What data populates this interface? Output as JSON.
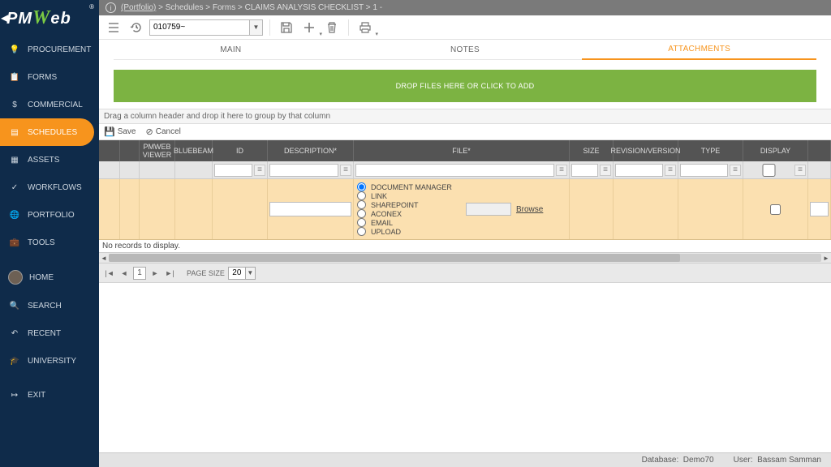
{
  "breadcrumb": {
    "portfolio": "(Portfolio)",
    "sep": ">",
    "p1": "Schedules",
    "p2": "Forms",
    "p3": "CLAIMS ANALYSIS CHECKLIST",
    "p4": "1 -"
  },
  "toolbar": {
    "record_id": "010759~"
  },
  "sidebar": {
    "items": [
      "PROCUREMENT",
      "FORMS",
      "COMMERCIAL",
      "SCHEDULES",
      "ASSETS",
      "WORKFLOWS",
      "PORTFOLIO",
      "TOOLS",
      "HOME",
      "SEARCH",
      "RECENT",
      "UNIVERSITY",
      "EXIT"
    ]
  },
  "tabs": {
    "main": "MAIN",
    "notes": "NOTES",
    "attachments": "ATTACHMENTS"
  },
  "dropzone": "DROP FILES HERE OR CLICK TO ADD",
  "group_bar": "Drag a column header and drop it here to group by that column",
  "actions": {
    "save": "Save",
    "cancel": "Cancel"
  },
  "cols": {
    "pmweb": "PMWEB VIEWER",
    "bluebeam": "BLUEBEAM",
    "id": "ID",
    "description": "DESCRIPTION*",
    "file": "FILE*",
    "size": "SIZE",
    "revision": "REVISION/VERSION",
    "type": "TYPE",
    "display": "DISPLAY"
  },
  "radio": {
    "docmgr": "DOCUMENT MANAGER",
    "link": "LINK",
    "sharepoint": "SHAREPOINT",
    "aconex": "ACONEX",
    "email": "EMAIL",
    "upload": "UPLOAD"
  },
  "file_cell": {
    "browse": "Browse"
  },
  "grid": {
    "no_records": "No records to display."
  },
  "pager": {
    "page": "1",
    "page_size_label": "PAGE SIZE",
    "page_size": "20"
  },
  "status": {
    "db_label": "Database:",
    "db": "Demo70",
    "user_label": "User:",
    "user": "Bassam Samman"
  }
}
